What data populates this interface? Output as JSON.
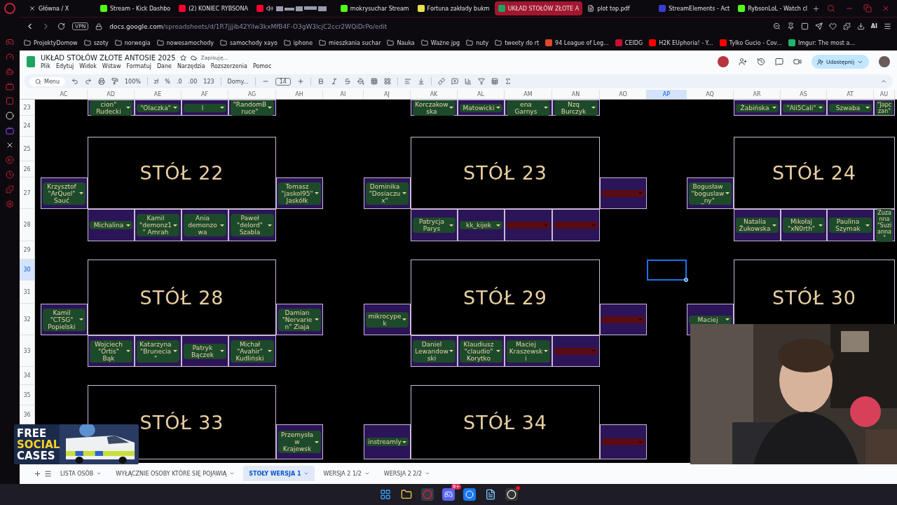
{
  "browser": {
    "tabs": [
      {
        "title": "Główna / X",
        "kind": "x",
        "selected": false
      },
      {
        "title": "Stream - Kick Dashbo",
        "kind": "kick",
        "selected": false
      },
      {
        "title": "(2) KONIEC RYBSONA",
        "kind": "youtube",
        "selected": false
      },
      {
        "kind": "redacted",
        "selected": false
      },
      {
        "title": "mokrysuchar Stream",
        "kind": "kick",
        "selected": false
      },
      {
        "title": "Fortuna zakłady bukm",
        "kind": "ring",
        "selected": false
      },
      {
        "title": "UKŁAD STOŁÓW ZŁOTE A",
        "kind": "sheets",
        "selected": true
      },
      {
        "title": "plot top.pdf",
        "kind": "file",
        "selected": false
      },
      {
        "title": "StreamElements - Act",
        "kind": "se",
        "selected": false
      },
      {
        "title": "RybsonLoL - Watch cl",
        "kind": "kick",
        "selected": false
      }
    ],
    "vpn": "VPN",
    "url_host": "docs.google.com",
    "url_path": "/spreadsheets/d/1R7jjjib42Yilw3kxMfB4F-O3gW3lcjC2ccr2WQiDrPo/edit",
    "ai": "AI",
    "bookmarks": [
      {
        "label": "ProjektyDomow",
        "kind": "folder"
      },
      {
        "label": "szoty",
        "kind": "folder"
      },
      {
        "label": "norwegia",
        "kind": "folder"
      },
      {
        "label": "nowesamochody",
        "kind": "folder"
      },
      {
        "label": "samochody xayo",
        "kind": "folder"
      },
      {
        "label": "iphone",
        "kind": "folder"
      },
      {
        "label": "mieszkania suchar",
        "kind": "folder"
      },
      {
        "label": "Nauka",
        "kind": "folder"
      },
      {
        "label": "Ważne jpg",
        "kind": "folder"
      },
      {
        "label": "nuty",
        "kind": "folder"
      },
      {
        "label": "tweety do rt",
        "kind": "folder"
      },
      {
        "label": "94 League of Leg...",
        "kind": "site",
        "color": "#e0482a"
      },
      {
        "label": "CEIDG",
        "kind": "site",
        "color": "#c8102e"
      },
      {
        "label": "H2K EUphoria! - Y...",
        "kind": "site",
        "color": "#ff0000"
      },
      {
        "label": "Tylko Gucio - Cov...",
        "kind": "site",
        "color": "#ff0000"
      },
      {
        "label": "Imgur: The most a...",
        "kind": "site",
        "color": "#1bb76e"
      }
    ]
  },
  "sheet": {
    "title": "UKŁAD STOŁÓW ZŁOTE ANTOSIE 2025",
    "status": "Zapisuję...",
    "menu": [
      "Plik",
      "Edytuj",
      "Widok",
      "Wstaw",
      "Formatuj",
      "Dane",
      "Narzędzia",
      "Rozszerzenia",
      "Pomoc"
    ],
    "share": "Udostępnij",
    "toolbar": {
      "search": "Menu",
      "zoom": "100%",
      "currency": "zł",
      "percent": "%",
      "dec_less": ".0",
      "dec_more": ".00",
      "number_format": "123",
      "font": "Domy...",
      "font_size": "14"
    },
    "columns": [
      {
        "label": "AC",
        "selected": false
      },
      {
        "label": "AD",
        "selected": false
      },
      {
        "label": "AE",
        "selected": false
      },
      {
        "label": "AF",
        "selected": false
      },
      {
        "label": "AG",
        "selected": false
      },
      {
        "label": "AH",
        "selected": false
      },
      {
        "label": "AI",
        "selected": false
      },
      {
        "label": "AJ",
        "selected": false
      },
      {
        "label": "AK",
        "selected": false
      },
      {
        "label": "AL",
        "selected": false
      },
      {
        "label": "AM",
        "selected": false
      },
      {
        "label": "AN",
        "selected": false
      },
      {
        "label": "AO",
        "selected": false
      },
      {
        "label": "AP",
        "selected": true
      },
      {
        "label": "AQ",
        "selected": false
      },
      {
        "label": "AR",
        "selected": false
      },
      {
        "label": "AS",
        "selected": false
      },
      {
        "label": "AT",
        "selected": false
      },
      {
        "label": "AU",
        "selected": false
      }
    ],
    "rows": [
      {
        "label": "23",
        "selected": false
      },
      {
        "label": "24",
        "selected": false
      },
      {
        "label": "25",
        "selected": false
      },
      {
        "label": "26",
        "selected": false
      },
      {
        "label": "27",
        "selected": false
      },
      {
        "label": "28",
        "selected": false
      },
      {
        "label": "29",
        "selected": false
      },
      {
        "label": "30",
        "selected": true
      },
      {
        "label": "31",
        "selected": false
      },
      {
        "label": "32",
        "selected": false
      },
      {
        "label": "33",
        "selected": false
      },
      {
        "label": "34",
        "selected": false
      },
      {
        "label": "35",
        "selected": false
      },
      {
        "label": "36",
        "selected": false
      }
    ],
    "bands": [
      {
        "tables": [
          {
            "bottom": [
              {
                "kind": "person",
                "name": "cion\" Rudecki"
              },
              {
                "kind": "person",
                "name": "\"Olaczka\""
              },
              {
                "kind": "person",
                "name": "l"
              },
              {
                "kind": "person",
                "name": "\"RandomBruce\""
              }
            ]
          },
          {
            "bottom": [
              {
                "kind": "person",
                "name": "Korczakowska"
              },
              {
                "kind": "person",
                "name": "Matowicki"
              },
              {
                "kind": "person",
                "name": "ena Garnys"
              },
              {
                "kind": "person",
                "name": "Nzq Burczyk"
              }
            ]
          },
          {
            "bottom": [
              {
                "kind": "person",
                "name": "Żabińska"
              },
              {
                "kind": "person",
                "name": "\"Ali5Cali\""
              },
              {
                "kind": "person",
                "name": "Szwaba"
              },
              {
                "kind": "person",
                "name": "\"Japczan\""
              }
            ]
          }
        ]
      },
      {
        "tables": [
          {
            "title": "STÓŁ 22",
            "left": {
              "kind": "person",
              "name": "Krzysztof \"ArQuel\" Sauć"
            },
            "right": {
              "kind": "person",
              "name": "Tomasz \"jaskol95\" Jaskółk"
            },
            "bottom": [
              {
                "kind": "person",
                "name": "Michalina"
              },
              {
                "kind": "person",
                "name": "Kamil \"demonz1\" Amrah"
              },
              {
                "kind": "person",
                "name": "Ania demonzowa"
              },
              {
                "kind": "person",
                "name": "Paweł \"delord\" Szabla"
              }
            ]
          },
          {
            "title": "STÓŁ 23",
            "left": {
              "kind": "person",
              "name": "Dominika \"Dosiaczux\""
            },
            "right": {
              "kind": "empty"
            },
            "bottom": [
              {
                "kind": "person",
                "name": "Patrycja Parys"
              },
              {
                "kind": "person",
                "name": "kk_kijek"
              },
              {
                "kind": "empty"
              },
              {
                "kind": "empty"
              }
            ]
          },
          {
            "title": "STÓŁ 24",
            "left": {
              "kind": "person",
              "name": "Bogusław \"boguslaw_ny\""
            },
            "bottom": [
              {
                "kind": "person",
                "name": "Natalia Żukowska"
              },
              {
                "kind": "person",
                "name": "Mikołaj \"xN0rth\""
              },
              {
                "kind": "person",
                "name": "Paulina Szymak"
              },
              {
                "kind": "person",
                "name": "Zuzanna \"Suzianna\""
              }
            ]
          }
        ]
      },
      {
        "tables": [
          {
            "title": "STÓŁ 28",
            "left": {
              "kind": "person",
              "name": "Kamil \"CTSG\" Popielski"
            },
            "right": {
              "kind": "person",
              "name": "Damian \"Nervarien\" Ziaja"
            },
            "bottom": [
              {
                "kind": "person",
                "name": "Wojciech \"Ortis\" Bąk"
              },
              {
                "kind": "person",
                "name": "Katarzyna \"Brunecia\""
              },
              {
                "kind": "person",
                "name": "Patryk Bączek"
              },
              {
                "kind": "person",
                "name": "Michał \"Avahir\" Kudliński"
              }
            ]
          },
          {
            "title": "STÓŁ 29",
            "left": {
              "kind": "person",
              "name": "mikrocypek"
            },
            "right": {
              "kind": "empty"
            },
            "bottom": [
              {
                "kind": "person",
                "name": "Daniel Lewandowski"
              },
              {
                "kind": "person",
                "name": "Klaudiusz \"claudio\" Korytko"
              },
              {
                "kind": "person",
                "name": "Maciej Kraszewski"
              },
              {
                "kind": "empty"
              }
            ]
          },
          {
            "title": "STÓŁ 30",
            "left": {
              "kind": "person",
              "name": "Maciej"
            }
          }
        ]
      },
      {
        "tables": [
          {
            "title": "STÓŁ 33",
            "right": {
              "kind": "person",
              "name": "Przemysław Krajewsk"
            }
          },
          {
            "title": "STÓŁ 34",
            "left": {
              "kind": "person",
              "name": "instreamly"
            },
            "right": {
              "kind": "empty"
            }
          }
        ]
      }
    ],
    "sheet_tabs": [
      {
        "label": "LISTA OSÓB",
        "selected": false
      },
      {
        "label": "WYŁĄCZNIE OSOBY KTÓRE SIĘ POJAWIĄ",
        "selected": false
      },
      {
        "label": "STOŁY WERSJA 1",
        "selected": true
      },
      {
        "label": "WERSJA 2 1/2",
        "selected": false
      },
      {
        "label": "WERSJA 2 2/2",
        "selected": false
      }
    ]
  },
  "ad_overlay": {
    "lines": [
      "FREE",
      "SOCIAL",
      "CASES"
    ]
  },
  "taskbar": {
    "badge": "9+"
  }
}
